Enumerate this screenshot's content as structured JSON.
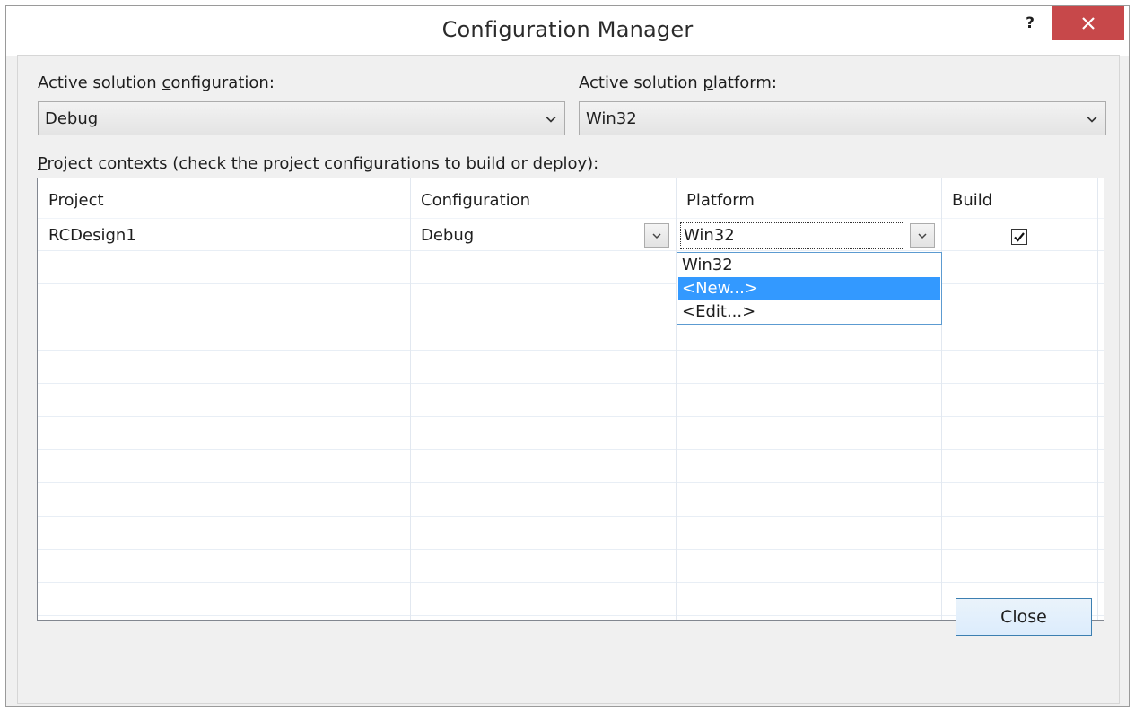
{
  "window": {
    "title": "Configuration Manager",
    "help_label": "?",
    "close_icon": "close-icon",
    "accent": "#c7484a"
  },
  "solution": {
    "config_label_pre": "Active solution ",
    "config_label_key": "c",
    "config_label_post": "onfiguration:",
    "config_value": "Debug",
    "platform_label_pre": "Active solution ",
    "platform_label_key": "p",
    "platform_label_post": "latform:",
    "platform_value": "Win32"
  },
  "contexts": {
    "label_key": "P",
    "label_post": "roject contexts (check the project configurations to build or deploy):",
    "columns": [
      "Project",
      "Configuration",
      "Platform",
      "Build"
    ],
    "rows": [
      {
        "project": "RCDesign1",
        "configuration": "Debug",
        "platform": "Win32",
        "build": true
      }
    ],
    "platform_dropdown": {
      "items": [
        "Win32",
        "<New...>",
        "<Edit...>"
      ],
      "selected": "<New...>",
      "selected_color": "#3399ff"
    }
  },
  "footer": {
    "close_label": "Close"
  }
}
